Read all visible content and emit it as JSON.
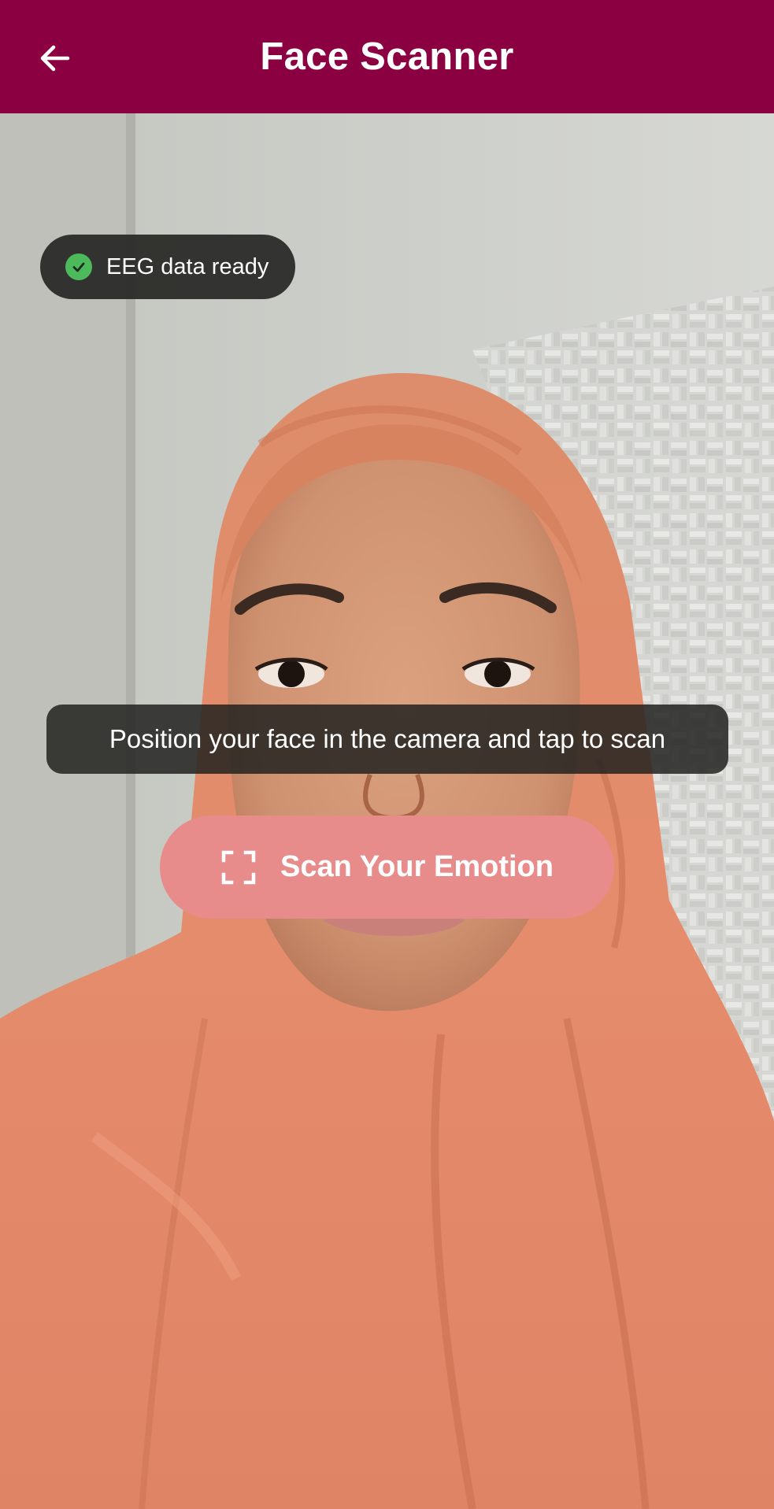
{
  "app_bar": {
    "title": "Face Scanner",
    "back_icon": "arrow-left-icon",
    "color": "#8b0040"
  },
  "status_chip": {
    "label": "EEG data ready",
    "icon": "check-circle-icon",
    "icon_color": "#4cba5b"
  },
  "instruction": {
    "text": "Position your face in the camera and tap to scan"
  },
  "scan_button": {
    "label": "Scan Your Emotion",
    "icon": "scan-frame-icon",
    "color": "#e88b8b"
  }
}
